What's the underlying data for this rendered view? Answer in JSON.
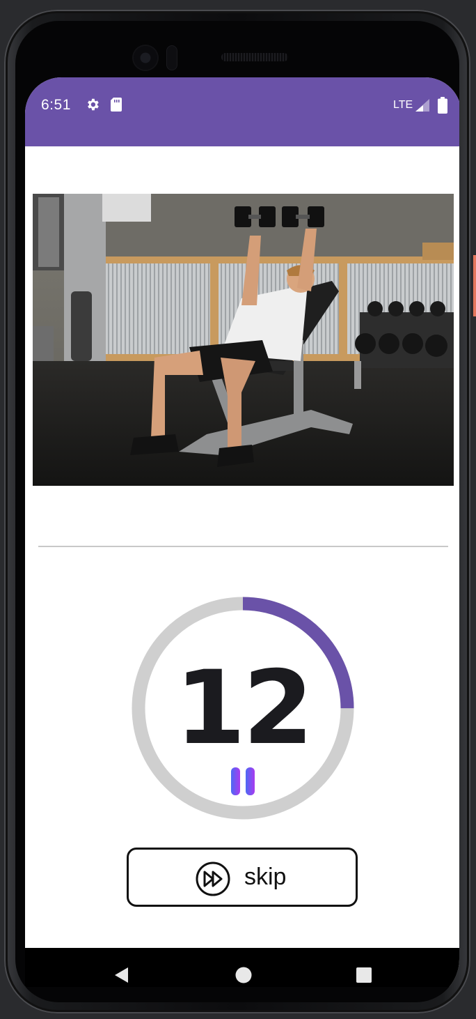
{
  "status_bar": {
    "time": "6:51",
    "network": "LTE",
    "icons": [
      "gear-icon",
      "sd-card-icon",
      "signal-icon",
      "battery-icon"
    ],
    "color": "#6a52a8"
  },
  "exercise": {
    "image_alt": "Incline dumbbell press"
  },
  "timer": {
    "remaining": "12",
    "progress_fraction": 0.25,
    "progress_color": "#6a52a8",
    "track_color": "#cfcfcf"
  },
  "skip": {
    "label": "skip",
    "icon": "fast-forward-icon"
  },
  "nav": {
    "icons": [
      "back-icon",
      "home-icon",
      "recents-icon"
    ]
  }
}
